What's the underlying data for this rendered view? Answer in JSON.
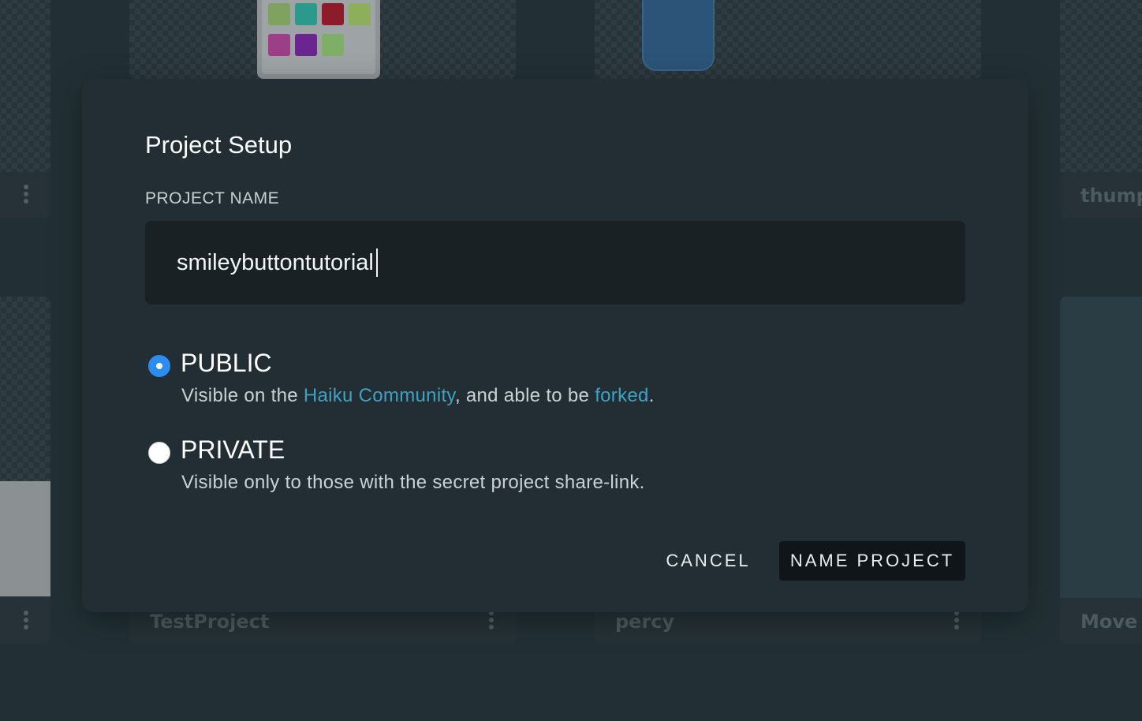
{
  "background_projects": [
    {
      "name": ""
    },
    {
      "name": ""
    },
    {
      "name": ""
    },
    {
      "name": "thump"
    },
    {
      "name": ""
    },
    {
      "name": "TestProject"
    },
    {
      "name": "percy"
    },
    {
      "name": "Move"
    }
  ],
  "modal": {
    "title": "Project Setup",
    "project_name_label": "PROJECT NAME",
    "project_name_value": "smileybuttontutorial",
    "options": [
      {
        "label": "PUBLIC",
        "checked": true,
        "desc_prefix": "Visible on the ",
        "link1": "Haiku Community",
        "desc_middle": ", and able to be ",
        "link2": "forked",
        "desc_suffix": "."
      },
      {
        "label": "PRIVATE",
        "checked": false,
        "desc": "Visible only to those with the secret project share-link."
      }
    ],
    "cancel_label": "CANCEL",
    "submit_label": "NAME PROJECT"
  },
  "colors": {
    "accent": "#2d8cf0",
    "link": "#3fa2c2",
    "modal_bg": "#222e33",
    "input_bg": "#192125"
  },
  "thumbnail_swatches": [
    "#7fa35e",
    "#2b9a8c",
    "#8e1b2a",
    "#8dae5a",
    "#9c3f86",
    "#6a2590",
    "#7fae68",
    "#9ea3a5"
  ]
}
